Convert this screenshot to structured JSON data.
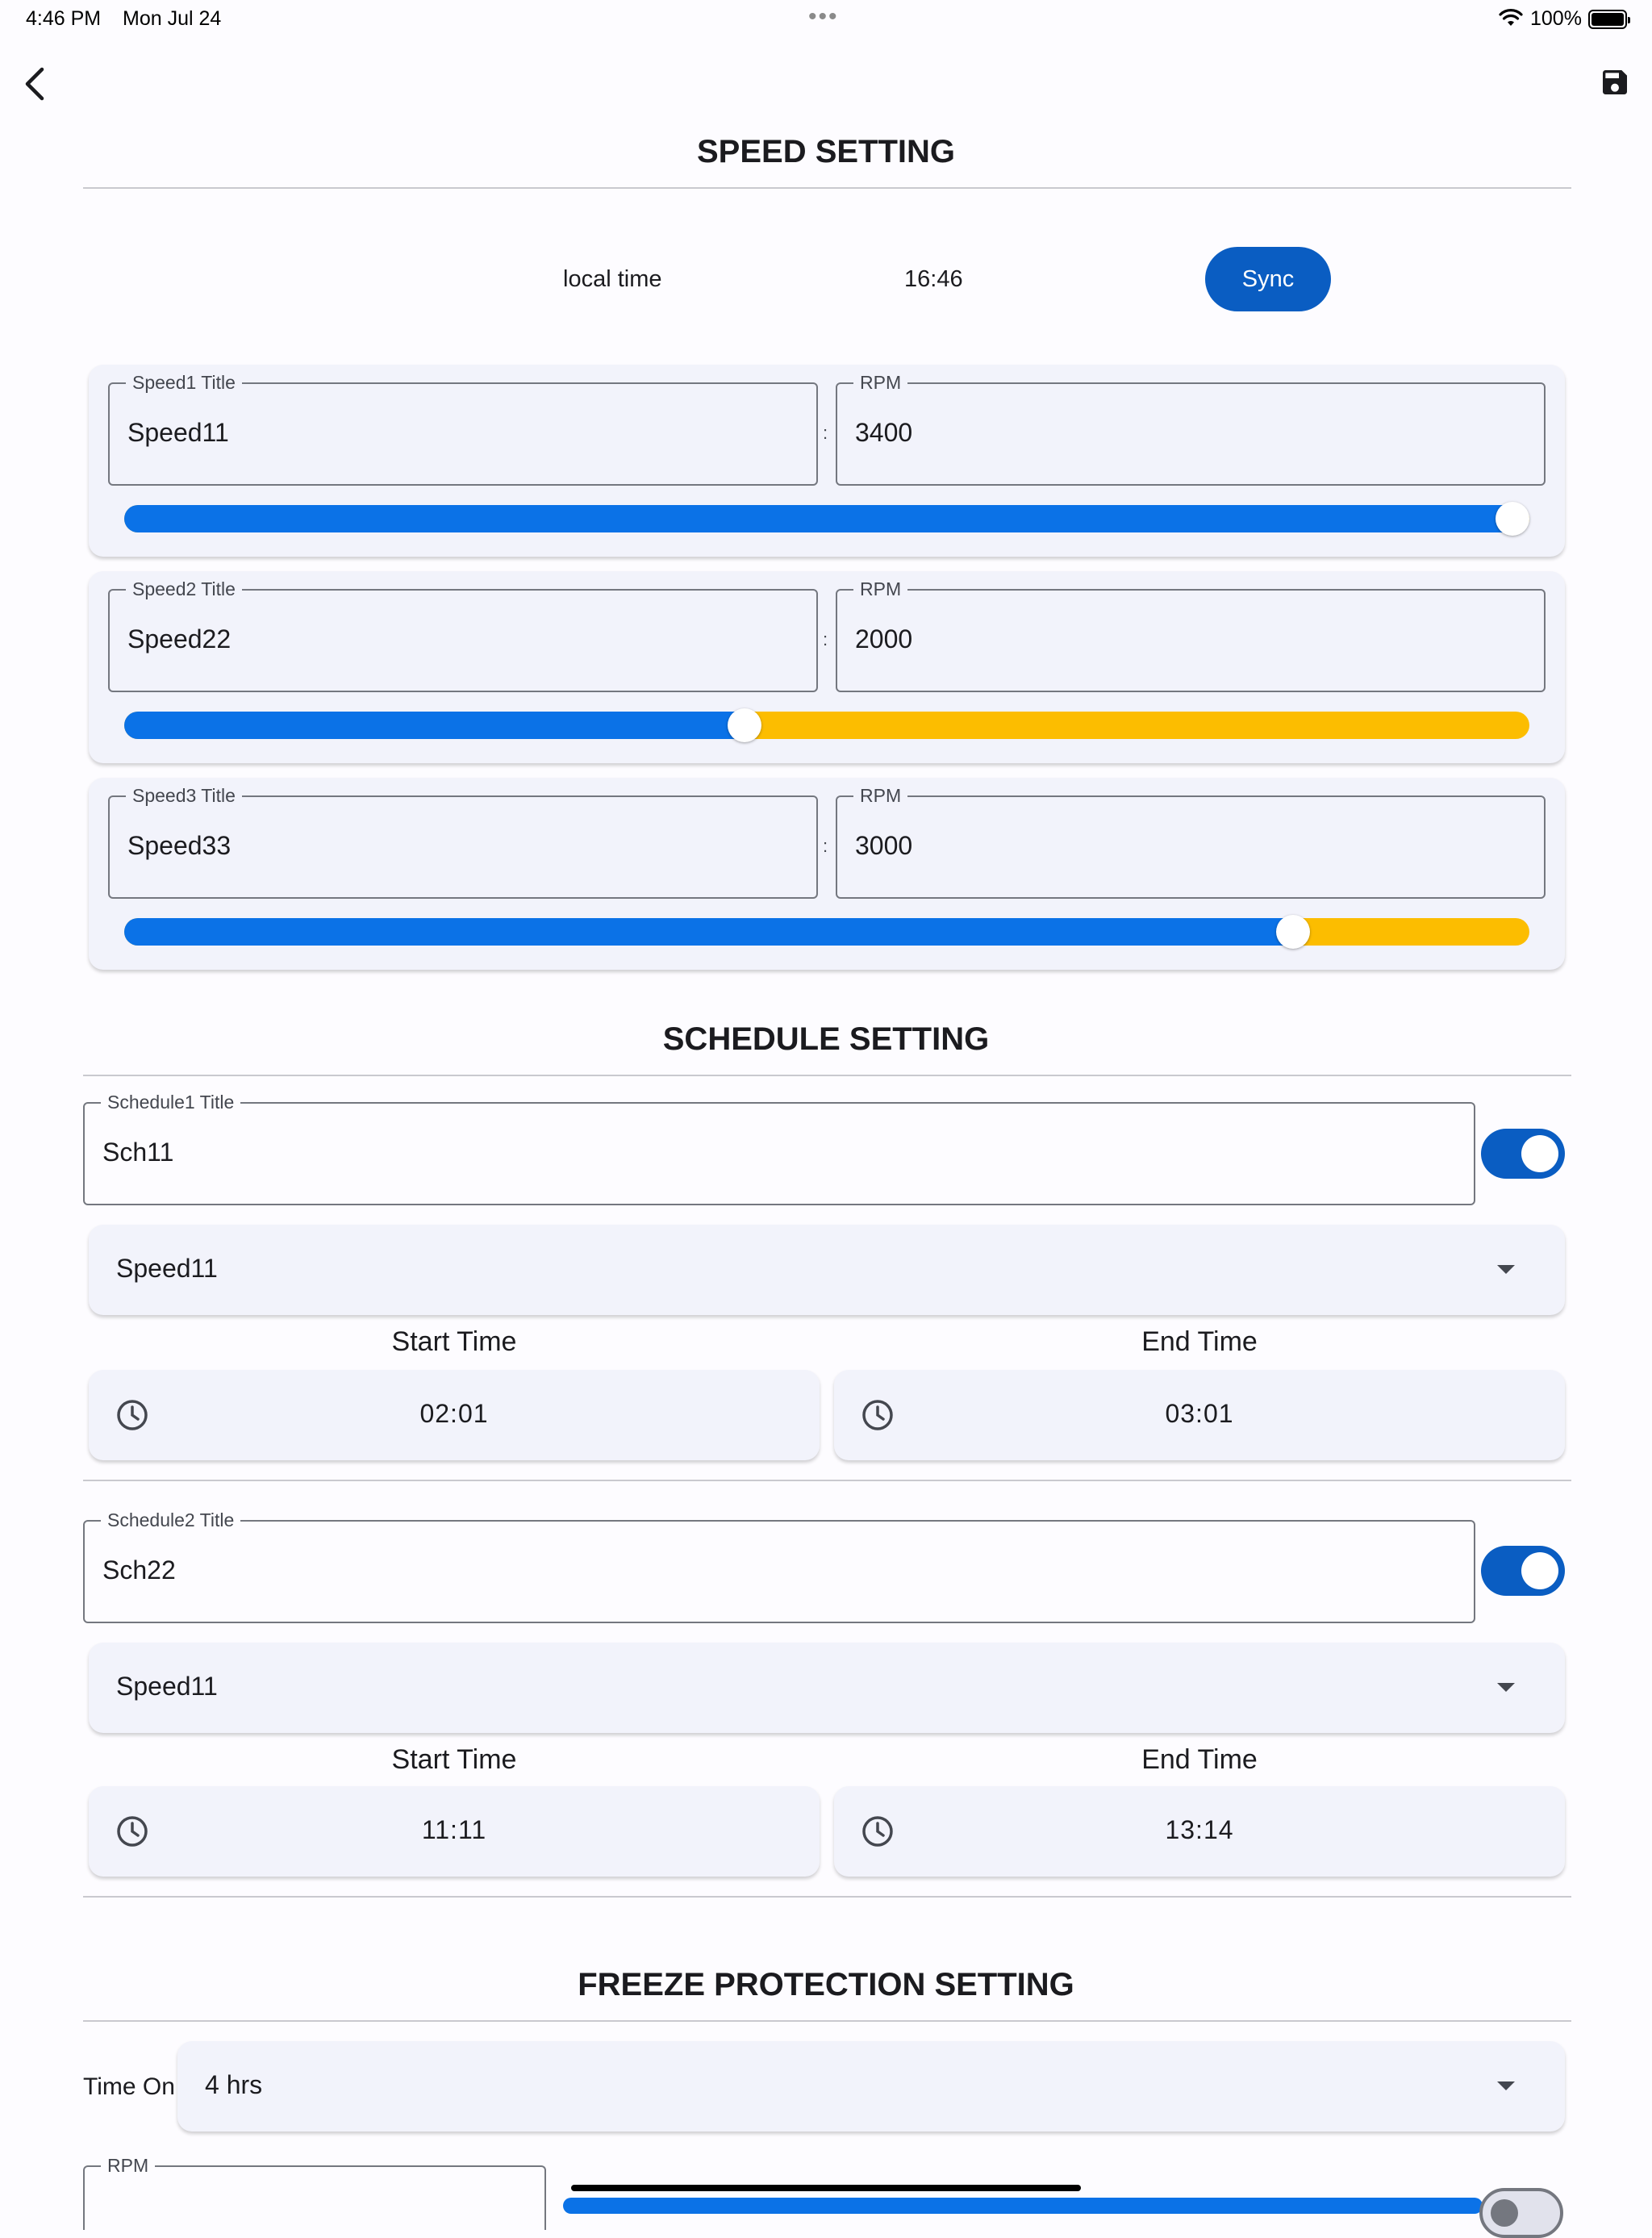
{
  "status_bar": {
    "time": "4:46 PM",
    "date": "Mon Jul 24",
    "battery": "100%"
  },
  "icons": {
    "back": "chevron-left-icon",
    "save": "floppy-disk-icon",
    "clock": "clock-icon",
    "dropdown": "caret-down-icon",
    "wifi": "wifi-icon",
    "battery": "battery-icon"
  },
  "colors": {
    "accent": "#0a5dc2",
    "slider_active": "#0b72e7",
    "slider_inactive": "#fcbd00"
  },
  "speed_setting": {
    "title": "SPEED SETTING",
    "local_time_label": "local time",
    "local_time_value": "16:46",
    "sync_label": "Sync",
    "speeds": [
      {
        "title_label": "Speed1 Title",
        "title_value": "Speed11",
        "rpm_label": "RPM",
        "rpm_value": "3400",
        "slider_fraction": 1.0
      },
      {
        "title_label": "Speed2 Title",
        "title_value": "Speed22",
        "rpm_label": "RPM",
        "rpm_value": "2000",
        "slider_fraction": 0.44
      },
      {
        "title_label": "Speed3 Title",
        "title_value": "Speed33",
        "rpm_label": "RPM",
        "rpm_value": "3000",
        "slider_fraction": 0.84
      }
    ]
  },
  "schedule_setting": {
    "title": "SCHEDULE SETTING",
    "schedules": [
      {
        "title_label": "Schedule1 Title",
        "title_value": "Sch11",
        "enabled": true,
        "speed": "Speed11",
        "start_label": "Start Time",
        "start": "02:01",
        "end_label": "End Time",
        "end": "03:01"
      },
      {
        "title_label": "Schedule2 Title",
        "title_value": "Sch22",
        "enabled": true,
        "speed": "Speed11",
        "start_label": "Start Time",
        "start": "11:11",
        "end_label": "End Time",
        "end": "13:14"
      }
    ]
  },
  "freeze_setting": {
    "title": "FREEZE PROTECTION SETTING",
    "time_on_label": "Time On",
    "time_on_value": "4 hrs",
    "rpm_label": "RPM"
  }
}
